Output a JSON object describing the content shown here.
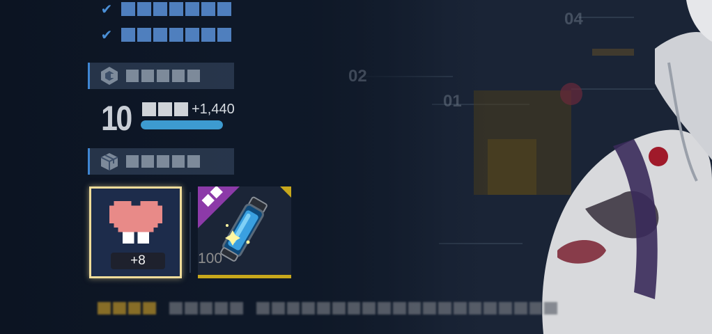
{
  "stats": {
    "rows": [
      {
        "check": "✔"
      },
      {
        "check": "✔"
      }
    ]
  },
  "level_section": {
    "icon": "hexagon-badge-icon",
    "level": "10",
    "exp_gain": "+1,440",
    "exp_progress_fraction": 1.0
  },
  "reward_section": {
    "icon": "box-icon",
    "items": [
      {
        "icon": "pixel-heart-icon",
        "amount": "+8",
        "selected": true
      },
      {
        "icon": "energy-vial-icon",
        "count": "100",
        "selected": false
      }
    ]
  },
  "background": {
    "lane_numbers": [
      "04",
      "02",
      "01"
    ]
  },
  "colors": {
    "accent_blue": "#3f86d2",
    "exp_bar": "#3d9bd0",
    "selected_border": "#f0dc9a",
    "rarity_purple": "#8c3aa8",
    "rarity_gold": "#c8a81c"
  }
}
